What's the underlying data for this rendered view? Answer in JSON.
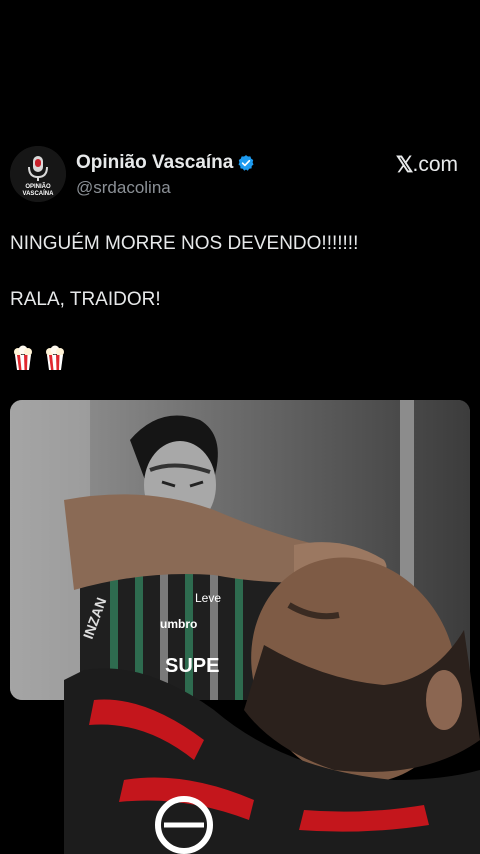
{
  "post": {
    "author_name": "Opinião Vascaína",
    "author_handle": "@srdacolina",
    "brand": {
      "mark": "𝕏",
      "suffix": ".com"
    },
    "avatar_text": {
      "line1": "OPINIÃO",
      "line2": "VASCAÍNA"
    },
    "lines": [
      "NINGUÉM MORRE NOS DEVENDO!!!!!!!",
      "RALA, TRAIDOR!"
    ],
    "emojis": [
      "popcorn",
      "popcorn"
    ]
  },
  "media": {
    "jersey_text": {
      "brand": "umbro",
      "sponsor": "SUPE",
      "sleeve": "INZAN",
      "logo": "Leve"
    }
  },
  "colors": {
    "background": "#000000",
    "text_primary": "#e7e9ea",
    "text_secondary": "#8b9096",
    "verified": "#1d9bf0"
  }
}
